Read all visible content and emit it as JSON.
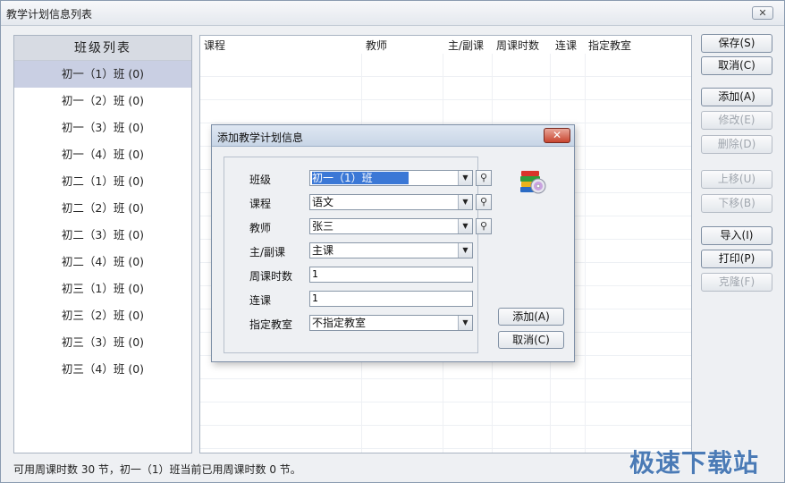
{
  "window": {
    "title": "教学计划信息列表",
    "close_label": "✕"
  },
  "class_panel": {
    "header": "班级列表",
    "items": [
      "初一（1）班 (0)",
      "初一（2）班 (0)",
      "初一（3）班 (0)",
      "初一（4）班 (0)",
      "初二（1）班 (0)",
      "初二（2）班 (0)",
      "初二（3）班 (0)",
      "初二（4）班 (0)",
      "初三（1）班 (0)",
      "初三（2）班 (0)",
      "初三（3）班 (0)",
      "初三（4）班 (0)"
    ]
  },
  "grid": {
    "columns": [
      "课程",
      "教师",
      "主/副课",
      "周课时数",
      "连课",
      "指定教室"
    ]
  },
  "buttons": {
    "save": "保存(S)",
    "cancel": "取消(C)",
    "add": "添加(A)",
    "edit": "修改(E)",
    "delete": "删除(D)",
    "move_up": "上移(U)",
    "move_down": "下移(B)",
    "import": "导入(I)",
    "print": "打印(P)",
    "clone": "克隆(F)"
  },
  "status": "可用周课时数 30 节，初一（1）班当前已用周课时数 0 节。",
  "watermark": "极速下载站",
  "dialog": {
    "title": "添加教学计划信息",
    "close_label": "✕",
    "fields": {
      "class_label": "班级",
      "class_value": "初一（1）班",
      "course_label": "课程",
      "course_value": "语文",
      "teacher_label": "教师",
      "teacher_value": "张三",
      "type_label": "主/副课",
      "type_value": "主课",
      "hours_label": "周课时数",
      "hours_value": "1",
      "consecutive_label": "连课",
      "consecutive_value": "1",
      "room_label": "指定教室",
      "room_value": "不指定教室"
    },
    "add_button": "添加(A)",
    "cancel_button": "取消(C)"
  },
  "colors": {
    "selected_row": "#c9cfe3",
    "panel_header": "#d7dbe3",
    "dialog_title": "#c8d5e6",
    "close_red": "#c8452f",
    "watermark": "#3a6fb0"
  }
}
